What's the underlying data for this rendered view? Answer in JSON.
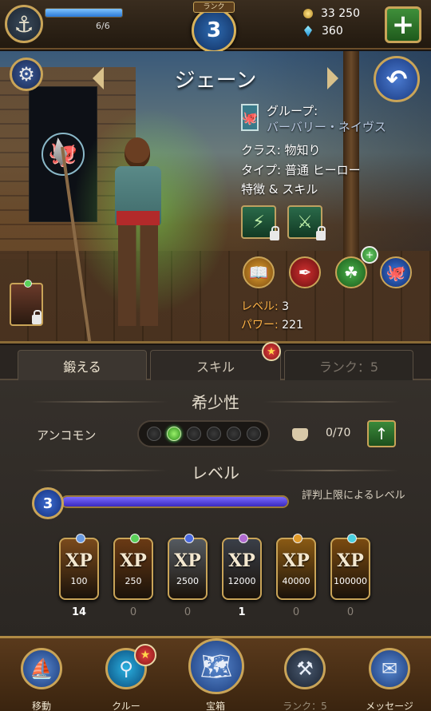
{
  "header": {
    "energy": "6/6",
    "energy_fill": 1.0,
    "rank_label": "ランク",
    "rank_value": "3",
    "gold": "33 250",
    "gems": "360",
    "plus_label": "+"
  },
  "hero": {
    "name": "ジェーン",
    "group_label": "グループ:",
    "group_value": "バーバリー・ネイヴス",
    "class_line": "クラス: 物知り",
    "type_line": "タイプ: 普通 ヒーロー",
    "traits_line": "特徴 & スキル",
    "skill_badge": "+",
    "level_key": "レベル:",
    "level_value": "3",
    "power_key": "パワー:",
    "power_value": "221"
  },
  "tabs": [
    {
      "label": "鍛える"
    },
    {
      "label": "スキル"
    },
    {
      "label": "ランク：5"
    }
  ],
  "tab_star": "★",
  "rarity": {
    "title": "希少性",
    "label": "アンコモン",
    "filled": 1,
    "total": 6,
    "shards": "0/70",
    "upgrade_label": "↑"
  },
  "level": {
    "title": "レベル",
    "value": "3",
    "fill": 1.0,
    "cap_text": "評判上限によるレベル"
  },
  "xp_items": [
    {
      "label": "XP",
      "amount": "100",
      "count": "14",
      "color": "#7a4a1c",
      "gem": "#6a9ae0"
    },
    {
      "label": "XP",
      "amount": "250",
      "count": "0",
      "color": "#6a3a14",
      "gem": "#5ad05a"
    },
    {
      "label": "XP",
      "amount": "2500",
      "count": "0",
      "color": "#555a60",
      "gem": "#4a6ae0"
    },
    {
      "label": "XP",
      "amount": "12000",
      "count": "1",
      "color": "#3a3f48",
      "gem": "#b06ad0"
    },
    {
      "label": "XP",
      "amount": "40000",
      "count": "0",
      "color": "#8a5a14",
      "gem": "#e09a2a"
    },
    {
      "label": "XP",
      "amount": "100000",
      "count": "0",
      "color": "#7a4a10",
      "gem": "#4ad0e0"
    }
  ],
  "nav": [
    {
      "label": "移動",
      "icon": "ship-icon"
    },
    {
      "label": "クルー",
      "icon": "crew-icon"
    },
    {
      "label": "宝箱",
      "icon": "treasure-map-icon"
    },
    {
      "label": "ランク：5",
      "icon": "anvil-icon"
    },
    {
      "label": "メッセージ",
      "icon": "envelope-icon"
    }
  ],
  "crew_star": "★"
}
